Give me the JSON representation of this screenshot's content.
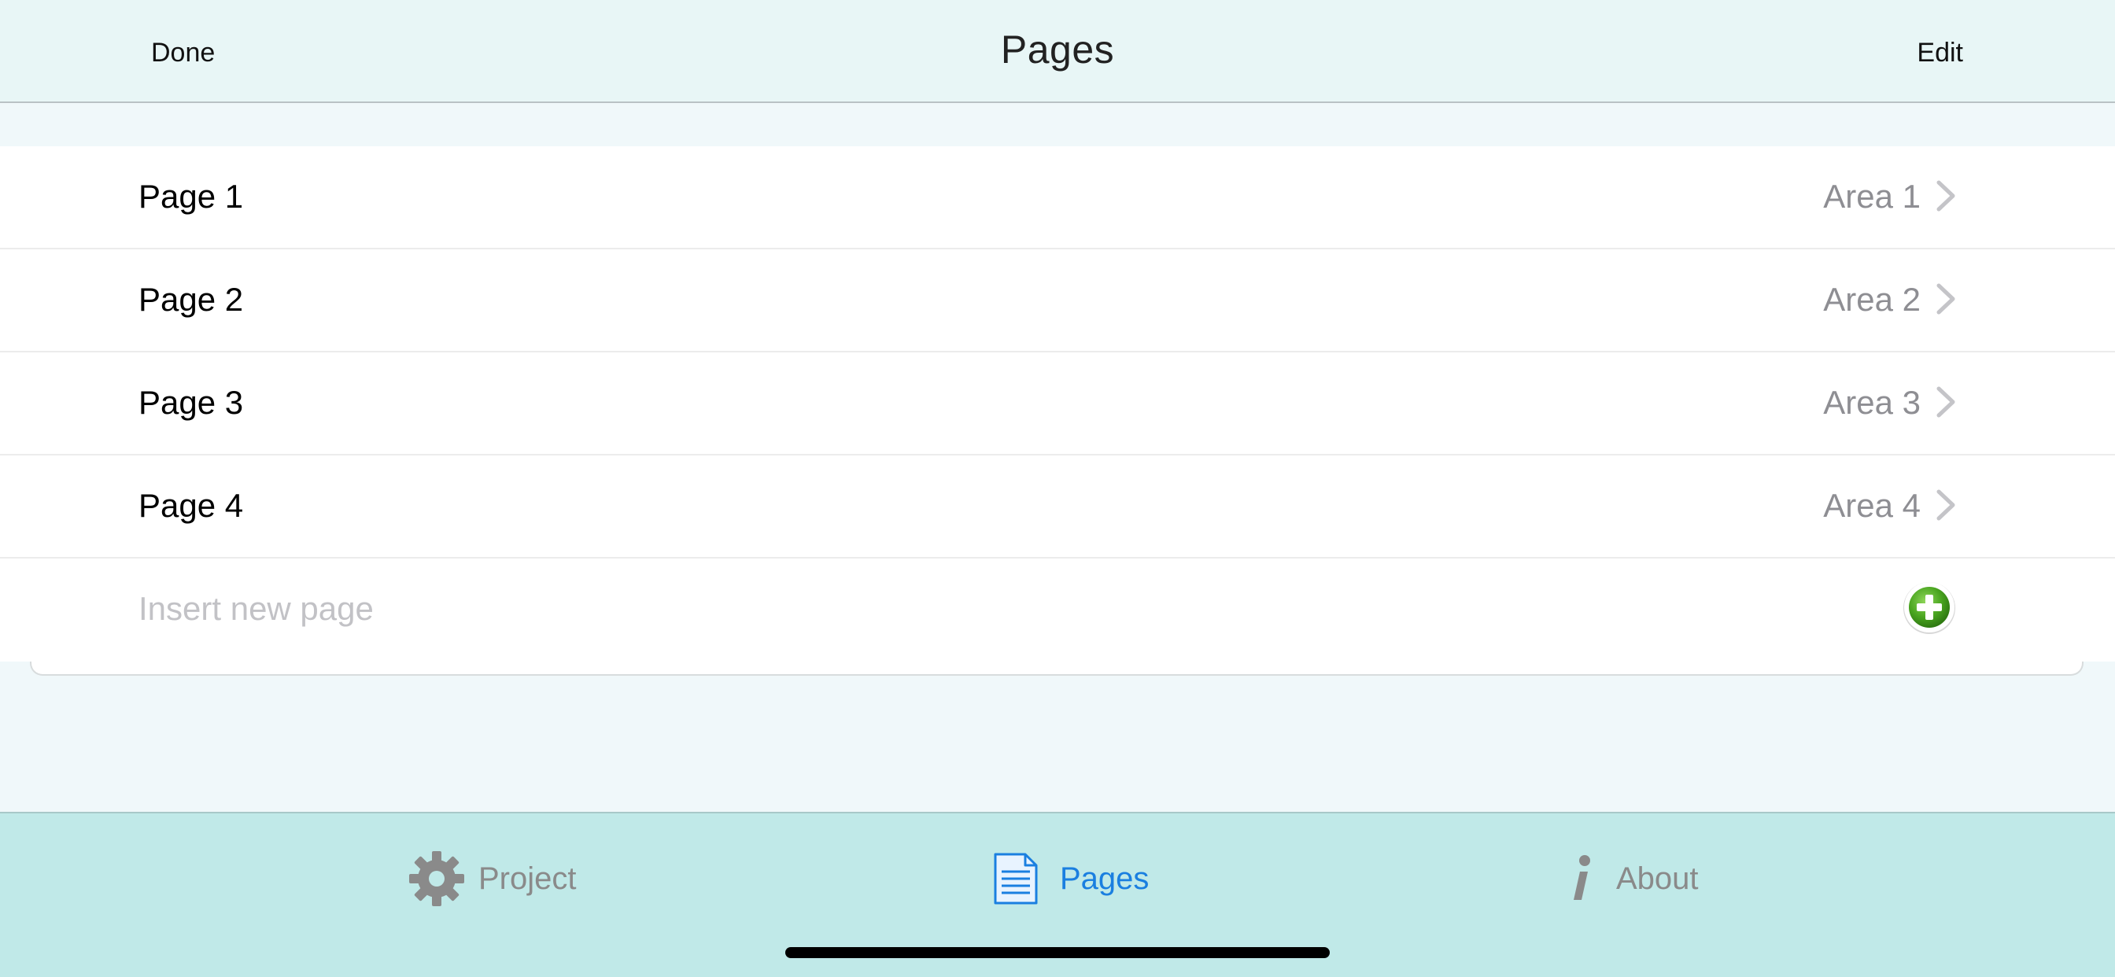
{
  "navbar": {
    "left_button": "Done",
    "title": "Pages",
    "right_button": "Edit"
  },
  "pages": [
    {
      "title": "Page 1",
      "area": "Area 1"
    },
    {
      "title": "Page 2",
      "area": "Area 2"
    },
    {
      "title": "Page 3",
      "area": "Area 3"
    },
    {
      "title": "Page 4",
      "area": "Area 4"
    }
  ],
  "insert": {
    "placeholder": "Insert new page",
    "button_icon": "add-circle-icon"
  },
  "tabbar": {
    "tabs": [
      {
        "label": "Project",
        "icon": "gear-icon",
        "selected": false
      },
      {
        "label": "Pages",
        "icon": "document-icon",
        "selected": true
      },
      {
        "label": "About",
        "icon": "info-icon",
        "selected": false
      }
    ]
  },
  "colors": {
    "accent": "#1a7fe0",
    "inactive_tab": "#8a8a8a",
    "add_green": "#4aa520"
  }
}
